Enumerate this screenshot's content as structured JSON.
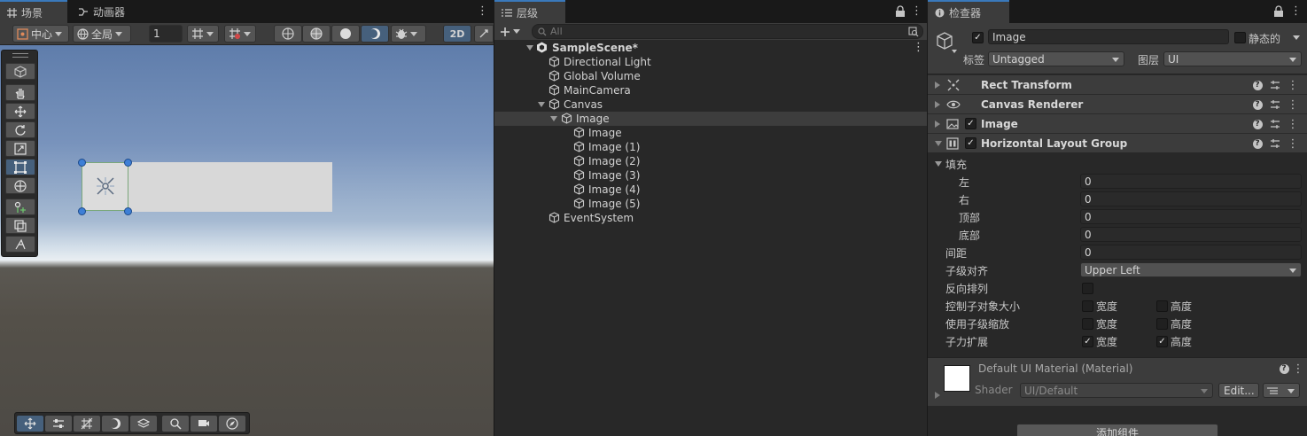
{
  "scene_panel": {
    "tabs": [
      {
        "label": "场景",
        "icon": "grid-icon"
      },
      {
        "label": "动画器",
        "icon": "animator-icon"
      }
    ],
    "toolbar": {
      "pivot_label": "中心",
      "space_label": "全局",
      "grid_size": "1",
      "mode_2d_label": "2D"
    }
  },
  "hierarchy_panel": {
    "tab_label": "层级",
    "search_placeholder": "All",
    "items": [
      {
        "label": "SampleScene*",
        "depth": 0,
        "expanded": true,
        "bold": true,
        "icon": "unity-scene-icon"
      },
      {
        "label": "Directional Light",
        "depth": 1,
        "icon": "gameobject-cube-icon"
      },
      {
        "label": "Global Volume",
        "depth": 1,
        "icon": "gameobject-cube-icon"
      },
      {
        "label": "MainCamera",
        "depth": 1,
        "icon": "gameobject-cube-icon"
      },
      {
        "label": "Canvas",
        "depth": 1,
        "expanded": true,
        "icon": "gameobject-cube-icon"
      },
      {
        "label": "Image",
        "depth": 2,
        "expanded": true,
        "selected": true,
        "icon": "gameobject-cube-icon"
      },
      {
        "label": "Image",
        "depth": 3,
        "icon": "gameobject-cube-icon"
      },
      {
        "label": "Image (1)",
        "depth": 3,
        "icon": "gameobject-cube-icon"
      },
      {
        "label": "Image (2)",
        "depth": 3,
        "icon": "gameobject-cube-icon"
      },
      {
        "label": "Image (3)",
        "depth": 3,
        "icon": "gameobject-cube-icon"
      },
      {
        "label": "Image (4)",
        "depth": 3,
        "icon": "gameobject-cube-icon"
      },
      {
        "label": "Image (5)",
        "depth": 3,
        "icon": "gameobject-cube-icon"
      },
      {
        "label": "EventSystem",
        "depth": 1,
        "icon": "gameobject-cube-icon"
      }
    ]
  },
  "inspector_panel": {
    "tab_label": "检查器",
    "object_name": "Image",
    "static_label": "静态的",
    "tag_label": "标签",
    "tag_value": "Untagged",
    "layer_label": "图层",
    "layer_value": "UI",
    "components": [
      {
        "name": "Rect Transform",
        "icon": "rect-transform-icon",
        "has_checkbox": false,
        "expanded": false
      },
      {
        "name": "Canvas Renderer",
        "icon": "eye-icon",
        "has_checkbox": false,
        "expanded": false
      },
      {
        "name": "Image",
        "icon": "image-component-icon",
        "has_checkbox": true,
        "expanded": false
      },
      {
        "name": "Horizontal Layout Group",
        "icon": "horizontal-layout-icon",
        "has_checkbox": true,
        "expanded": true
      }
    ],
    "layout_group": {
      "padding_label": "填充",
      "left_label": "左",
      "left_value": "0",
      "right_label": "右",
      "right_value": "0",
      "top_label": "顶部",
      "top_value": "0",
      "bottom_label": "底部",
      "bottom_value": "0",
      "spacing_label": "间距",
      "spacing_value": "0",
      "child_alignment_label": "子级对齐",
      "child_alignment_value": "Upper Left",
      "reverse_label": "反向排列",
      "control_size_label": "控制子对象大小",
      "use_scale_label": "使用子级缩放",
      "force_expand_label": "子力扩展",
      "width_label": "宽度",
      "height_label": "高度"
    },
    "material": {
      "name": "Default UI Material (Material)",
      "shader_label": "Shader",
      "shader_value": "UI/Default",
      "edit_label": "Edit..."
    },
    "add_component_label": "添加组件"
  },
  "colors": {
    "accent_blue": "#3a79bb",
    "selection_blue": "#46607c",
    "panel_bg": "#282828",
    "header_bg": "#3c3c3c",
    "handle_blue": "#3e7fd6"
  }
}
